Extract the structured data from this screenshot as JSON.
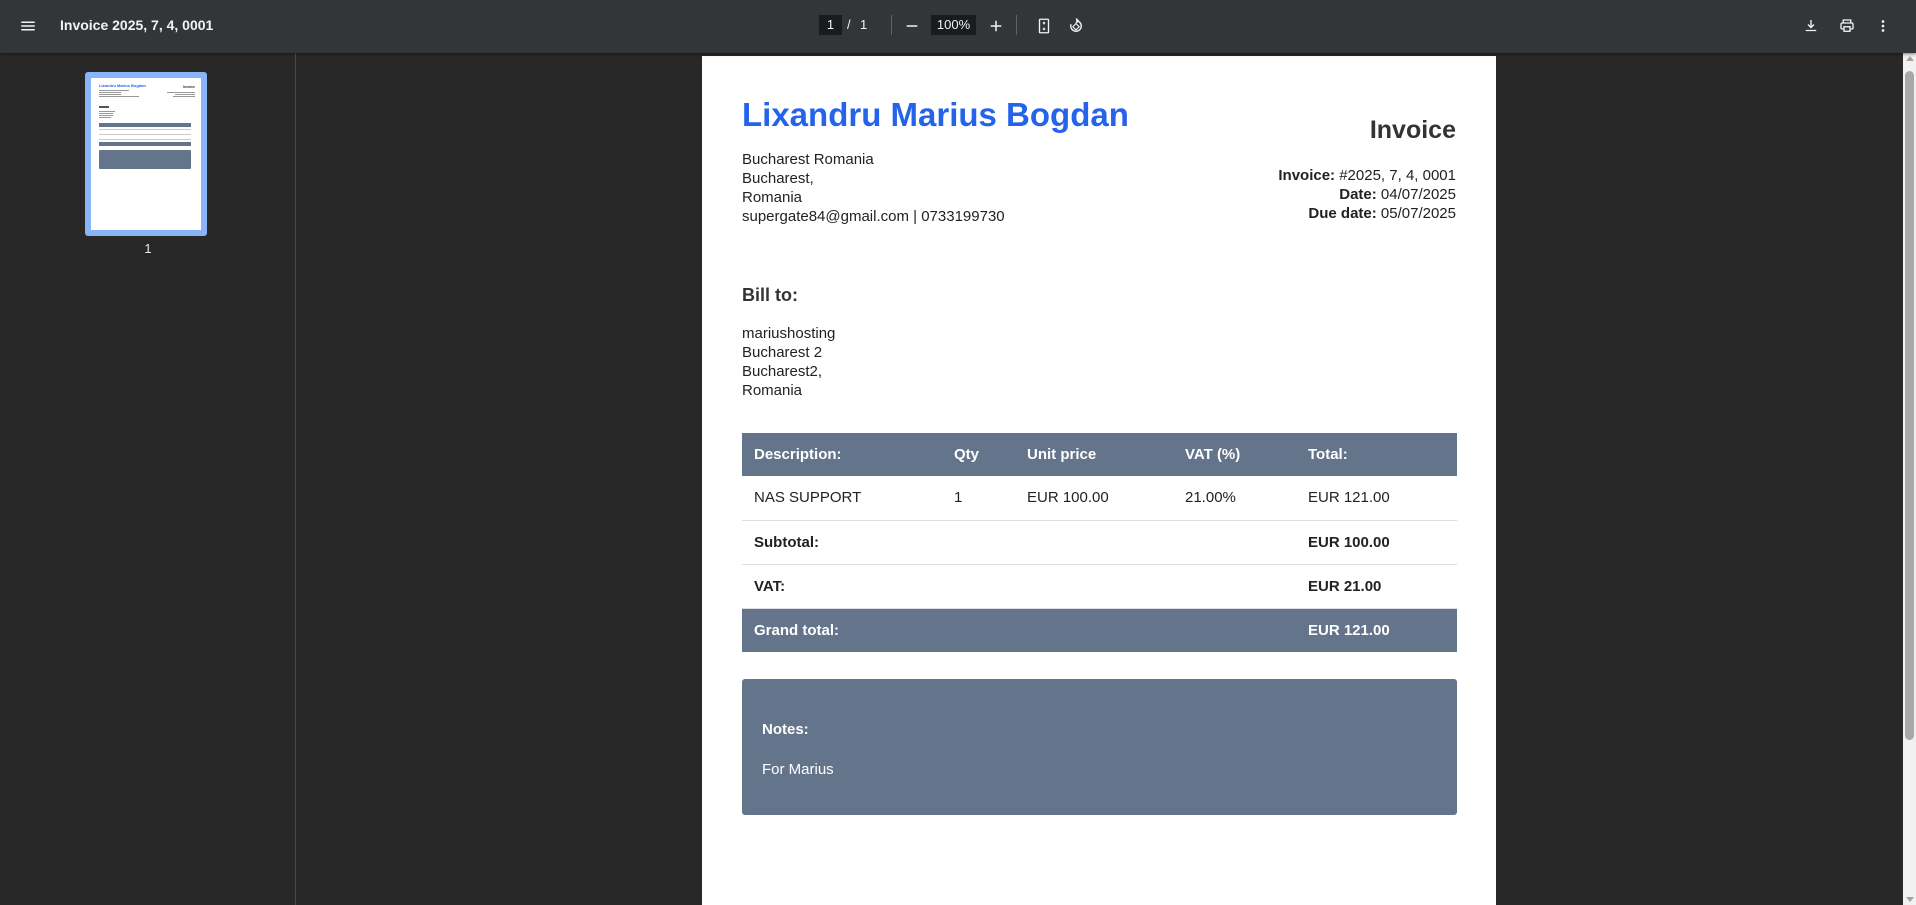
{
  "toolbar": {
    "title": "Invoice 2025, 7, 4, 0001",
    "page_current": "1",
    "page_separator": "/",
    "page_total": "1",
    "zoom": "100%"
  },
  "sidebar": {
    "thumbnail_label": "1",
    "thumb_name": "Lixandru Marius Bogdan",
    "thumb_heading": "Invoice"
  },
  "invoice": {
    "seller": {
      "name": "Lixandru Marius Bogdan",
      "lines": [
        "Bucharest Romania",
        "Bucharest,",
        "Romania",
        "supergate84@gmail.com | 0733199730"
      ]
    },
    "heading": "Invoice",
    "meta": {
      "invoice_label": "Invoice:",
      "invoice_value": "#2025, 7, 4, 0001",
      "date_label": "Date:",
      "date_value": "04/07/2025",
      "due_label": "Due date:",
      "due_value": "05/07/2025"
    },
    "bill_to": {
      "heading": "Bill to:",
      "lines": [
        "mariushosting",
        "Bucharest 2",
        "Bucharest2,",
        "Romania"
      ]
    },
    "table": {
      "headers": [
        "Description:",
        "Qty",
        "Unit price",
        "VAT (%)",
        "Total:"
      ],
      "rows": [
        [
          "NAS SUPPORT",
          "1",
          "EUR 100.00",
          "21.00%",
          "EUR 121.00"
        ]
      ],
      "subtotal_label": "Subtotal:",
      "subtotal_value": "EUR 100.00",
      "vat_label": "VAT:",
      "vat_value": "EUR 21.00",
      "grand_label": "Grand total:",
      "grand_value": "EUR 121.00"
    },
    "notes": {
      "title": "Notes:",
      "text": "For Marius"
    }
  },
  "colors": {
    "accent_blue": "#2563eb",
    "table_header": "#64748b",
    "toolbar_bg": "#323639",
    "viewer_bg": "#282828"
  }
}
